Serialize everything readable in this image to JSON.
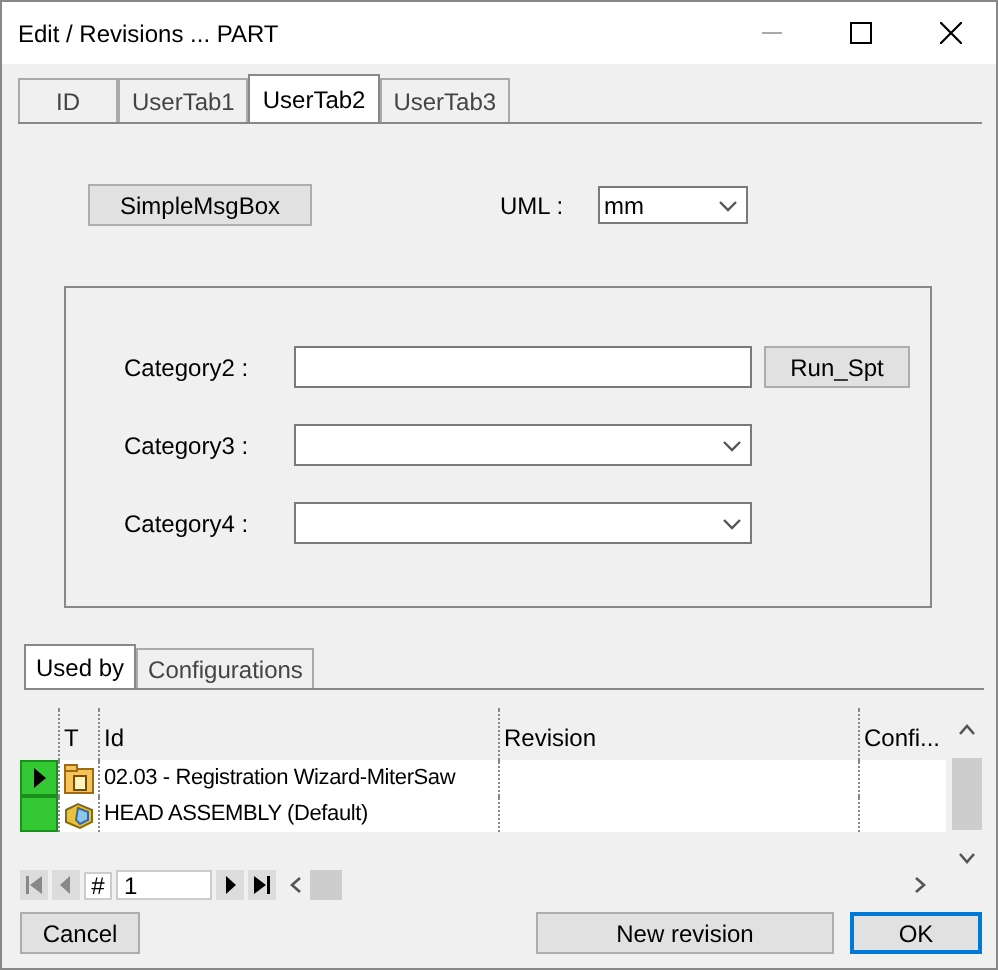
{
  "window": {
    "title": "Edit / Revisions ... PART"
  },
  "tabs": [
    {
      "label": "ID",
      "selected": false
    },
    {
      "label": "UserTab1",
      "selected": false
    },
    {
      "label": "UserTab2",
      "selected": true
    },
    {
      "label": "UserTab3",
      "selected": false
    }
  ],
  "top_button": "SimpleMsgBox",
  "uml": {
    "label": "UML :",
    "value": "mm"
  },
  "categories": [
    {
      "label": "Category2 :",
      "kind": "text",
      "button": "Run_Spt"
    },
    {
      "label": "Category3 :",
      "kind": "dropdown"
    },
    {
      "label": "Category4 :",
      "kind": "dropdown"
    }
  ],
  "bottom_tabs": [
    {
      "label": "Used by",
      "selected": true
    },
    {
      "label": "Configurations",
      "selected": false
    }
  ],
  "grid": {
    "columns": [
      "T",
      "Id",
      "Revision",
      "Confi..."
    ],
    "rows": [
      {
        "selected": true,
        "kind": "part",
        "id": "02.03 - Registration Wizard-MiterSaw"
      },
      {
        "selected": false,
        "kind": "assembly",
        "id": "HEAD ASSEMBLY (Default)"
      }
    ]
  },
  "navigator": {
    "hash": "#",
    "page": "1"
  },
  "buttons": [
    {
      "label": "Cancel",
      "kind": "cancel"
    },
    {
      "label": "New revision",
      "kind": "action"
    },
    {
      "label": "OK",
      "kind": "default"
    }
  ]
}
